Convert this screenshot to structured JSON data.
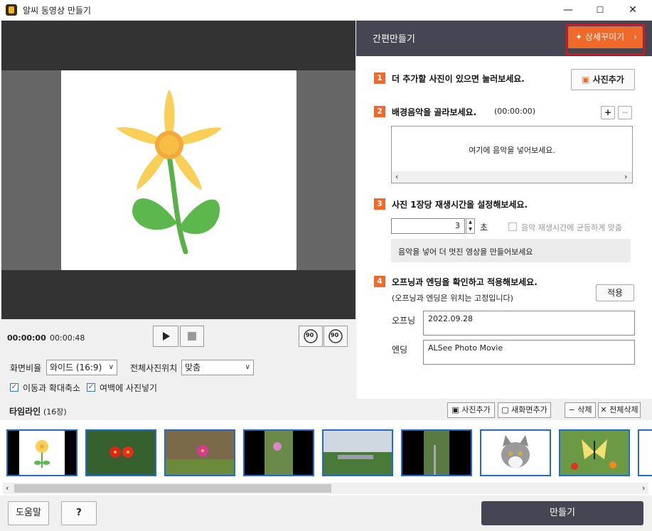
{
  "window": {
    "title": "알씨 동영상 만들기",
    "minimize": "—",
    "maximize": "☐",
    "close": "✕"
  },
  "player": {
    "current_time": "00:00:00",
    "total_time": "00:00:48",
    "play_icon": "play-icon",
    "stop_icon": "stop-icon",
    "rotate_left_label": "90",
    "rotate_right_label": "90"
  },
  "options": {
    "aspect_label": "화면비율",
    "aspect_value": "와이드 (16:9)",
    "position_label": "전체사진위치",
    "position_value": "맞춤",
    "pan_zoom_label": "이동과 확대축소",
    "pan_zoom_checked": true,
    "fill_margin_label": "여백에 사진넣기",
    "fill_margin_checked": true
  },
  "panel": {
    "title": "간편만들기",
    "detail_button": "상세꾸미기",
    "step1": {
      "num": "1",
      "text": "더 추가할 사진이 있으면 눌러보세요.",
      "button": "사진추가"
    },
    "step2": {
      "num": "2",
      "text": "배경음악을 골라보세요.",
      "duration": "(00:00:00)",
      "add": "+",
      "remove": "−",
      "placeholder": "여기에 음악을 넣어보세요."
    },
    "step3": {
      "num": "3",
      "text": "사진 1장당 재생시간을 설정해보세요.",
      "seconds_value": "3",
      "seconds_unit": "초",
      "equal_label": "음악 재생시간에 균등하게 맞춤",
      "hint": "음악을 넣어 더 멋진 영상을 만들어보세요"
    },
    "step4": {
      "num": "4",
      "text": "오프닝과 엔딩을 확인하고 적용해보세요.",
      "note": "(오프닝과 엔딩은 위치는 고정입니다)",
      "apply": "적용",
      "opening_label": "오프닝",
      "opening_value": "2022.09.28",
      "ending_label": "엔딩",
      "ending_value": "ALSee Photo Movie"
    }
  },
  "timeline": {
    "title": "타임라인",
    "count": "(16장)",
    "add_photo": "사진추가",
    "add_screen": "새화면추가",
    "delete": "삭제",
    "delete_all": "전체삭제",
    "thumbnails": [
      "flower-illustration",
      "red-flowers",
      "pink-cosmos-ground",
      "cosmos-portrait",
      "field-landscape",
      "fence-portrait",
      "cat",
      "butterfly"
    ]
  },
  "footer": {
    "help": "도움말",
    "question": "?",
    "make": "만들기"
  },
  "colors": {
    "accent": "#ef6a2a",
    "header": "#454553",
    "selection": "#1e6cd0",
    "highlight": "#e11111"
  }
}
